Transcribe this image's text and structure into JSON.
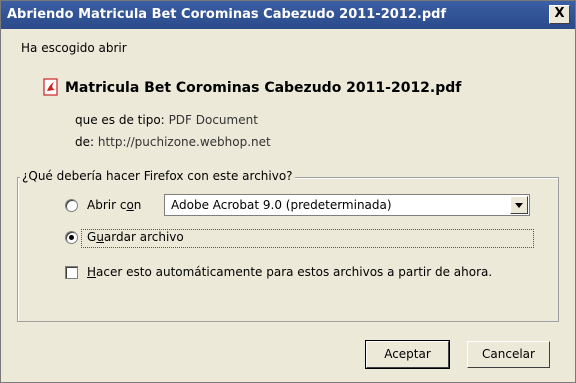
{
  "window": {
    "title": "Abriendo Matricula Bet Corominas Cabezudo 2011-2012.pdf",
    "close_label": "X"
  },
  "intro": "Ha escogido abrir",
  "file": {
    "name": "Matricula Bet Corominas Cabezudo 2011-2012.pdf",
    "type_label": "que es de tipo:",
    "type_value": "PDF Document",
    "from_label": "de:",
    "from_value": "http://puchizone.webhop.net"
  },
  "group": {
    "legend": "¿Qué debería hacer Firefox con este archivo?",
    "open_with": {
      "label_prefix": "Abrir c",
      "label_mnemonic": "o",
      "label_suffix": "n",
      "selected": false,
      "app_value": "Adobe Acrobat 9.0 (predeterminada)"
    },
    "save": {
      "label_prefix": "G",
      "label_mnemonic": "u",
      "label_suffix": "ardar archivo",
      "selected": true
    },
    "auto": {
      "label_mnemonic": "H",
      "label_suffix": "acer esto automáticamente para estos archivos a partir de ahora.",
      "checked": false
    }
  },
  "buttons": {
    "accept": "Aceptar",
    "cancel": "Cancelar"
  },
  "icons": {
    "file_type": "pdf-icon",
    "close": "close-icon"
  },
  "colors": {
    "titlebar": "#2f5596",
    "dialog_bg": "#ece9d8",
    "pdf_icon": "#cc2222"
  }
}
